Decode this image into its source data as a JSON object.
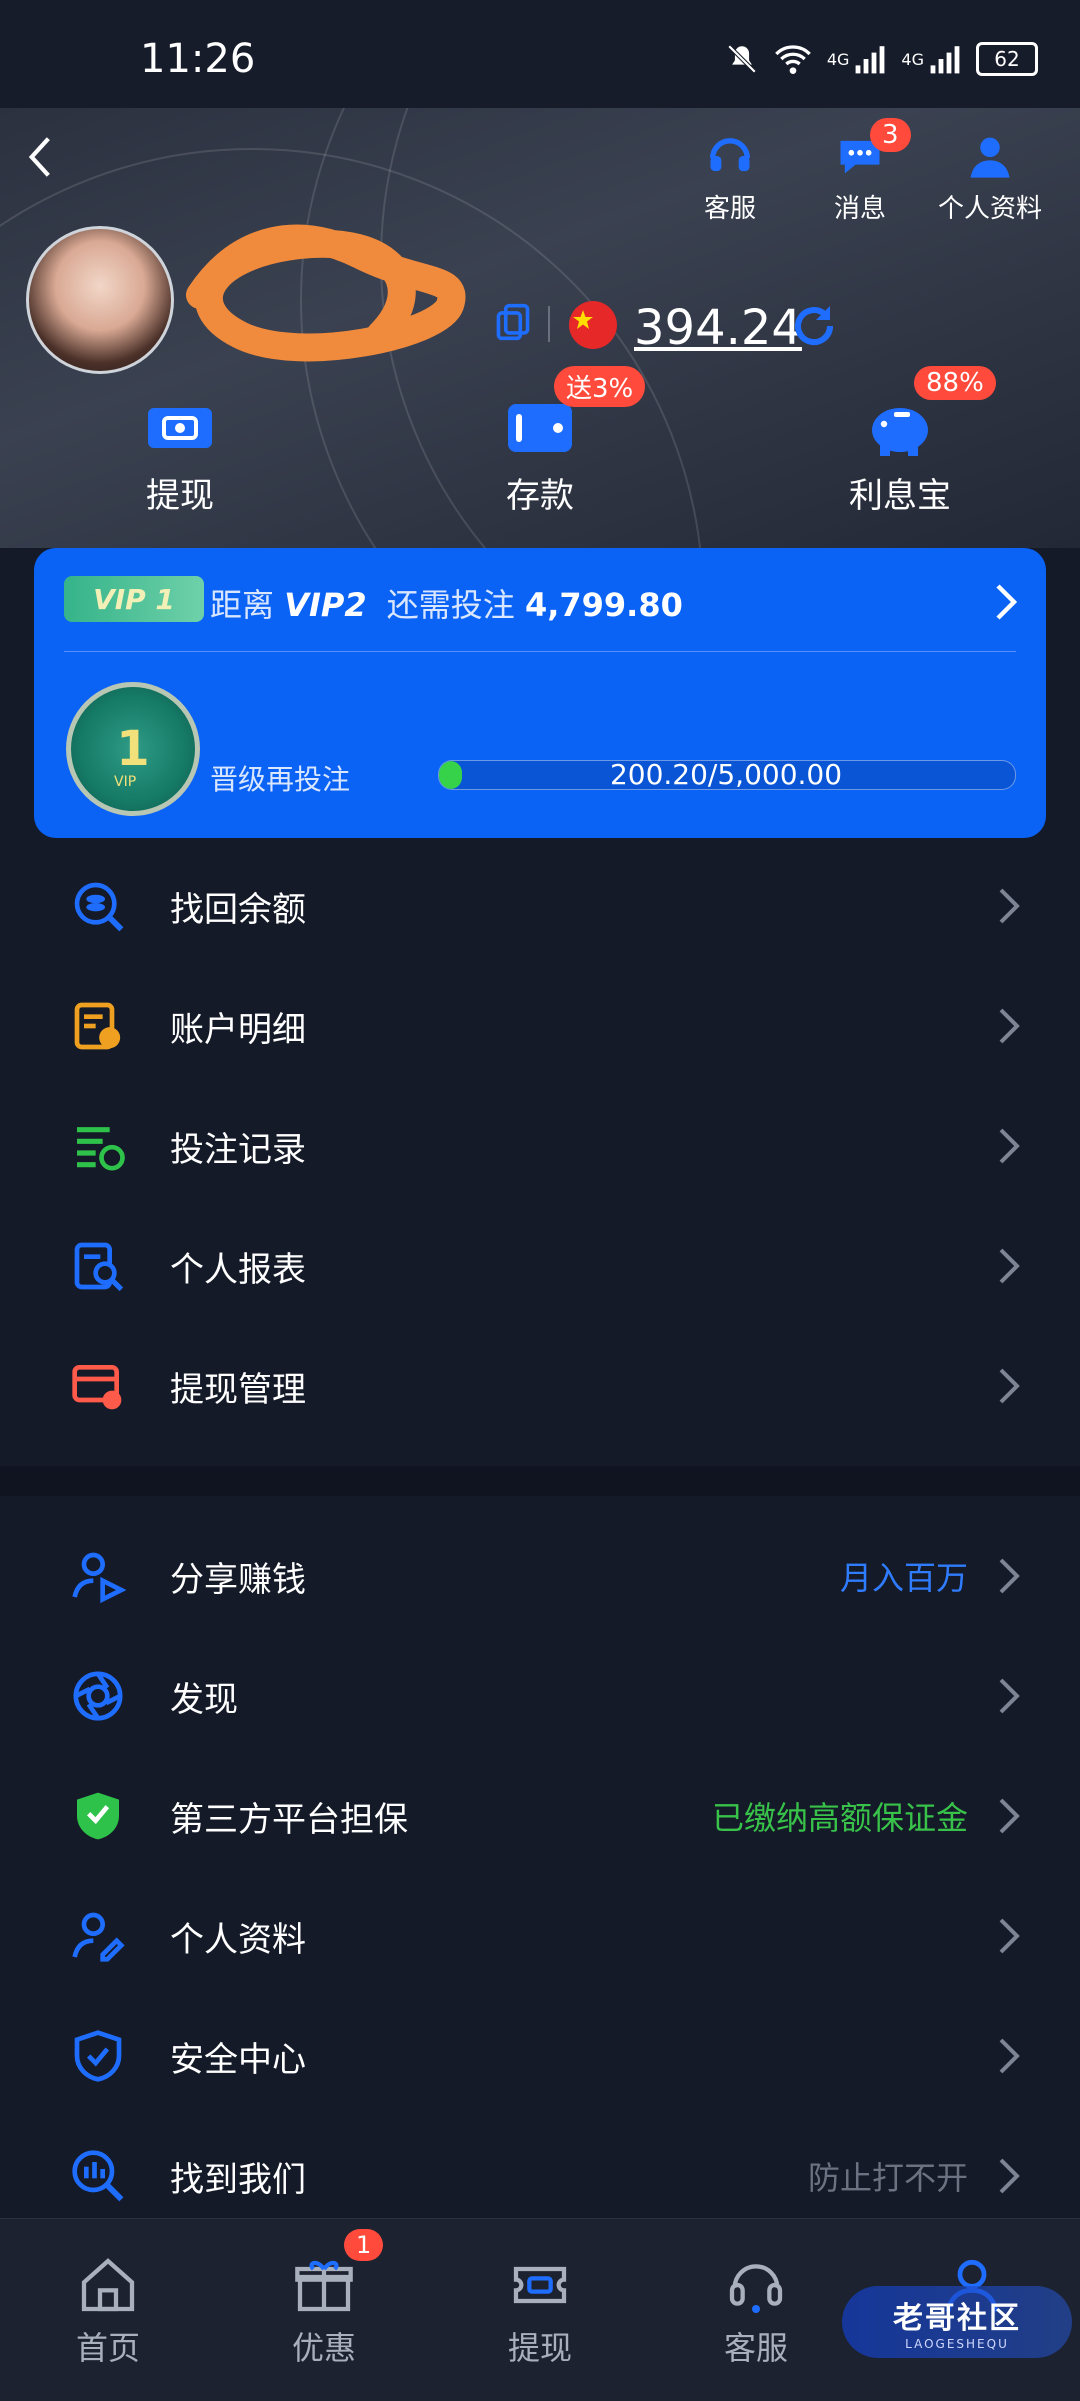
{
  "status_bar": {
    "time": "11:26",
    "battery": "62",
    "network1": "4G",
    "network2": "4G"
  },
  "header": {
    "actions": [
      {
        "label": "客服",
        "icon": "headset-icon"
      },
      {
        "label": "消息",
        "icon": "message-icon",
        "badge": "3"
      },
      {
        "label": "个人资料",
        "icon": "profile-icon"
      }
    ],
    "balance": "394.24",
    "currency_flag": "china-flag-icon",
    "quick_actions": [
      {
        "label": "提现",
        "icon": "withdraw-icon",
        "badge": ""
      },
      {
        "label": "存款",
        "icon": "wallet-icon",
        "badge": "送3%"
      },
      {
        "label": "利息宝",
        "icon": "piggy-bank-icon",
        "badge": "88%"
      }
    ]
  },
  "vip": {
    "tag": "VIP 1",
    "distance_prefix": "距离",
    "next_level": "VIP2",
    "need_text": "还需投注",
    "need_amount": "4,799.80",
    "medal_level": "1",
    "medal_sub": "VIP",
    "upgrade_label": "晋级再投注",
    "progress_text": "200.20/5,000.00",
    "progress_fraction": 0.04
  },
  "menu_group1": [
    {
      "label": "找回余额",
      "icon": "recover-balance-icon",
      "right": ""
    },
    {
      "label": "账户明细",
      "icon": "account-details-icon",
      "right": ""
    },
    {
      "label": "投注记录",
      "icon": "bet-records-icon",
      "right": ""
    },
    {
      "label": "个人报表",
      "icon": "personal-report-icon",
      "right": ""
    },
    {
      "label": "提现管理",
      "icon": "withdraw-manage-icon",
      "right": ""
    }
  ],
  "menu_group2": [
    {
      "label": "分享赚钱",
      "icon": "share-earn-icon",
      "right": "月入百万",
      "right_color": "#2f7cff"
    },
    {
      "label": "发现",
      "icon": "discover-icon",
      "right": ""
    },
    {
      "label": "第三方平台担保",
      "icon": "guarantee-shield-icon",
      "right": "已缴纳高额保证金",
      "right_color": "#39c24a"
    },
    {
      "label": "个人资料",
      "icon": "user-edit-icon",
      "right": ""
    },
    {
      "label": "安全中心",
      "icon": "security-shield-icon",
      "right": ""
    },
    {
      "label": "找到我们",
      "icon": "find-us-icon",
      "right": "防止打不开",
      "right_color": "#6b7383"
    }
  ],
  "tabbar": [
    {
      "label": "首页",
      "icon": "home-icon"
    },
    {
      "label": "优惠",
      "icon": "gift-icon",
      "badge": "1"
    },
    {
      "label": "提现",
      "icon": "ticket-icon"
    },
    {
      "label": "客服",
      "icon": "headset-icon"
    },
    {
      "label": "",
      "icon": "person-icon"
    }
  ],
  "watermark": {
    "title": "老哥社区",
    "subtitle": "LAOGESHEQU"
  },
  "colors": {
    "accent": "#0a63f5",
    "background": "#141a27",
    "badge_red": "#ff4a3c",
    "success": "#39c24a"
  }
}
